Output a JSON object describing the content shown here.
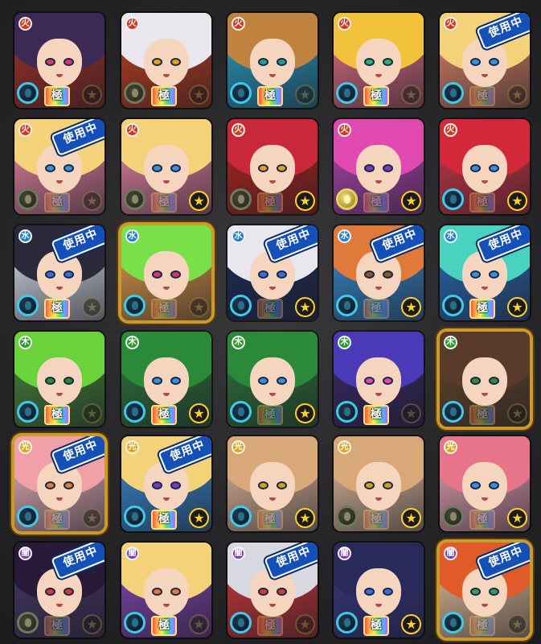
{
  "colors": {
    "fire": "#d23a1e",
    "water": "#1e7fd2",
    "wood": "#2f9a2f",
    "light": "#d9a81a",
    "dark": "#7a3ab8",
    "badge": "#1450b8",
    "gold_frame": "#c99a2c"
  },
  "monster_box": {
    "rows": [
      {
        "attribute": "fire",
        "attribute_icon": "fire-attribute-icon",
        "cards": [
          {
            "char": "dark-haired-maiden",
            "bg": "#a83328",
            "hair": "#3c2a55",
            "eye": "#d23a6a",
            "in_use": false,
            "plate": true,
            "star_active": false,
            "orb": "normal",
            "gold_frame": false
          },
          {
            "char": "white-haired-demon",
            "bg": "#c6421e",
            "hair": "#e9e6ee",
            "eye": "#e0a020",
            "in_use": false,
            "plate": true,
            "star_active": false,
            "orb": "dim",
            "gold_frame": false
          },
          {
            "char": "brown-bob-girl",
            "bg": "#2ba3c8",
            "hair": "#c0823f",
            "eye": "#2a9a8a",
            "in_use": false,
            "plate": true,
            "star_active": false,
            "orb": "normal",
            "gold_frame": false
          },
          {
            "char": "blonde-idol",
            "bg": "#e8748a",
            "hair": "#f2c23a",
            "eye": "#2fb06a",
            "in_use": false,
            "plate": true,
            "star_active": false,
            "orb": "normal",
            "gold_frame": false
          },
          {
            "char": "blonde-knight",
            "bg": "#e88a6a",
            "hair": "#f3d27a",
            "eye": "#3a8fd6",
            "in_use": true,
            "plate": false,
            "star_active": false,
            "orb": "normal",
            "gold_frame": false
          }
        ]
      },
      {
        "attribute": "fire",
        "attribute_icon": "fire-attribute-icon",
        "cards": [
          {
            "char": "blonde-knight",
            "bg": "#f08aa8",
            "hair": "#f3d27a",
            "eye": "#3a8fd6",
            "in_use": true,
            "plate": false,
            "star_active": false,
            "orb": "dim",
            "gold_frame": false
          },
          {
            "char": "blonde-knight",
            "bg": "#f08aa8",
            "hair": "#f3d27a",
            "eye": "#3a8fd6",
            "in_use": false,
            "plate": false,
            "star_active": true,
            "orb": "dim",
            "gold_frame": false
          },
          {
            "char": "red-haired-swordswoman",
            "bg": "#b8281e",
            "hair": "#c8283a",
            "eye": "#e0a020",
            "in_use": false,
            "plate": false,
            "star_active": true,
            "orb": "dim",
            "gold_frame": false
          },
          {
            "char": "pink-haired-girl",
            "bg": "#b84ab8",
            "hair": "#e04ab0",
            "eye": "#7a3ab8",
            "in_use": false,
            "plate": false,
            "star_active": true,
            "orb": "lit",
            "gold_frame": false
          },
          {
            "char": "crimson-mage",
            "bg": "#d83a4a",
            "hair": "#d2283a",
            "eye": "#3a8fd6",
            "in_use": false,
            "plate": false,
            "star_active": true,
            "orb": "normal",
            "gold_frame": false
          }
        ]
      },
      {
        "attribute": "water",
        "attribute_icon": "water-attribute-icon",
        "cards": [
          {
            "char": "ink-spirit",
            "bg": "#dfe7ef",
            "hair": "#2a2a3a",
            "eye": "#3a6fd6",
            "in_use": true,
            "plate": true,
            "star_active": false,
            "orb": "normal",
            "gold_frame": false
          },
          {
            "char": "green-haired-hero",
            "bg": "#e8a04a",
            "hair": "#7ae04a",
            "eye": "#d23a6a",
            "in_use": false,
            "plate": false,
            "star_active": false,
            "orb": "normal",
            "gold_frame": true
          },
          {
            "char": "split-haired-hero",
            "bg": "#1e2e5a",
            "hair": "#e9e6ee",
            "eye": "#3a6fd6",
            "in_use": true,
            "plate": false,
            "star_active": true,
            "orb": "normal",
            "gold_frame": false
          },
          {
            "char": "orange-haired-swordswoman",
            "bg": "#3a8fd6",
            "hair": "#e07a3a",
            "eye": "#8a5a2a",
            "in_use": true,
            "plate": false,
            "star_active": true,
            "orb": "normal",
            "gold_frame": false
          },
          {
            "char": "teal-haired-knight",
            "bg": "#2a6fb8",
            "hair": "#4ad2c0",
            "eye": "#3a8fd6",
            "in_use": true,
            "plate": true,
            "star_active": true,
            "orb": "normal",
            "gold_frame": false
          }
        ]
      },
      {
        "attribute": "wood",
        "attribute_icon": "wood-attribute-icon",
        "cards": [
          {
            "char": "green-berserker",
            "bg": "#4a8a3a",
            "hair": "#6ad23a",
            "eye": "#2a8a2a",
            "in_use": false,
            "plate": true,
            "star_active": false,
            "orb": "normal",
            "gold_frame": false
          },
          {
            "char": "forest-priestess",
            "bg": "#2f7a3a",
            "hair": "#2a8a3a",
            "eye": "#3a8fd6",
            "in_use": false,
            "plate": true,
            "star_active": true,
            "orb": "normal",
            "gold_frame": false
          },
          {
            "char": "forest-priestess",
            "bg": "#2f7a3a",
            "hair": "#2a8a3a",
            "eye": "#3a8fd6",
            "in_use": false,
            "plate": false,
            "star_active": true,
            "orb": "normal",
            "gold_frame": false
          },
          {
            "char": "purple-mecha-girl",
            "bg": "#3a2a6a",
            "hair": "#4a3ab8",
            "eye": "#e04ab0",
            "in_use": false,
            "plate": true,
            "star_active": false,
            "orb": "normal",
            "gold_frame": false
          },
          {
            "char": "scarred-warrior",
            "bg": "#6a4a2a",
            "hair": "#5a3a2a",
            "eye": "#3a8a3a",
            "in_use": false,
            "plate": false,
            "star_active": false,
            "orb": "normal",
            "gold_frame": true
          }
        ]
      },
      {
        "attribute": "light",
        "attribute_icon": "light-attribute-icon",
        "cards": [
          {
            "char": "pink-twin-tail",
            "bg": "#f0b8c0",
            "hair": "#f2a0a8",
            "eye": "#e07a3a",
            "in_use": true,
            "plate": false,
            "star_active": false,
            "orb": "normal",
            "gold_frame": true
          },
          {
            "char": "tan-warrior-girl",
            "bg": "#3a8fd6",
            "hair": "#f3d27a",
            "eye": "#7a3ab8",
            "in_use": true,
            "plate": true,
            "star_active": true,
            "orb": "normal",
            "gold_frame": false
          },
          {
            "char": "ribbon-girl",
            "bg": "#e8c0a0",
            "hair": "#d8a878",
            "eye": "#d2a020",
            "in_use": false,
            "plate": false,
            "star_active": true,
            "orb": "normal",
            "gold_frame": false
          },
          {
            "char": "ribbon-girl",
            "bg": "#e8c0a0",
            "hair": "#d8a878",
            "eye": "#d2a020",
            "in_use": false,
            "plate": false,
            "star_active": true,
            "orb": "dim",
            "gold_frame": false
          },
          {
            "char": "pink-haired-fighter",
            "bg": "#f0a8b8",
            "hair": "#e8748a",
            "eye": "#3a8fd6",
            "in_use": false,
            "plate": false,
            "star_active": true,
            "orb": "dim",
            "gold_frame": false
          }
        ]
      },
      {
        "attribute": "dark",
        "attribute_icon": "dark-attribute-icon",
        "cards": [
          {
            "char": "masked-ninja",
            "bg": "#4a3a6a",
            "hair": "#2a1a3a",
            "eye": "#d23a3a",
            "in_use": true,
            "plate": false,
            "star_active": false,
            "orb": "dim",
            "gold_frame": false
          },
          {
            "char": "purple-sorceress",
            "bg": "#8a4ab8",
            "hair": "#f3d27a",
            "eye": "#e07a3a",
            "in_use": false,
            "plate": true,
            "star_active": false,
            "orb": "normal",
            "gold_frame": false
          },
          {
            "char": "silver-haired-boy",
            "bg": "#d83a3a",
            "hair": "#d8d8e0",
            "eye": "#d23a3a",
            "in_use": true,
            "plate": false,
            "star_active": false,
            "orb": "normal",
            "gold_frame": false
          },
          {
            "char": "black-swordsman",
            "bg": "#3a3a8a",
            "hair": "#2a2a5a",
            "eye": "#3a6fd6",
            "in_use": false,
            "plate": true,
            "star_active": true,
            "orb": "normal",
            "gold_frame": false
          },
          {
            "char": "redhead-girl",
            "bg": "#f0c8a0",
            "hair": "#e05a2a",
            "eye": "#3a9a5a",
            "in_use": true,
            "plate": false,
            "star_active": false,
            "orb": "normal",
            "gold_frame": true
          }
        ]
      }
    ]
  },
  "labels": {
    "in_use": "使用中",
    "ultimate": "極",
    "star_glyph": "★"
  }
}
